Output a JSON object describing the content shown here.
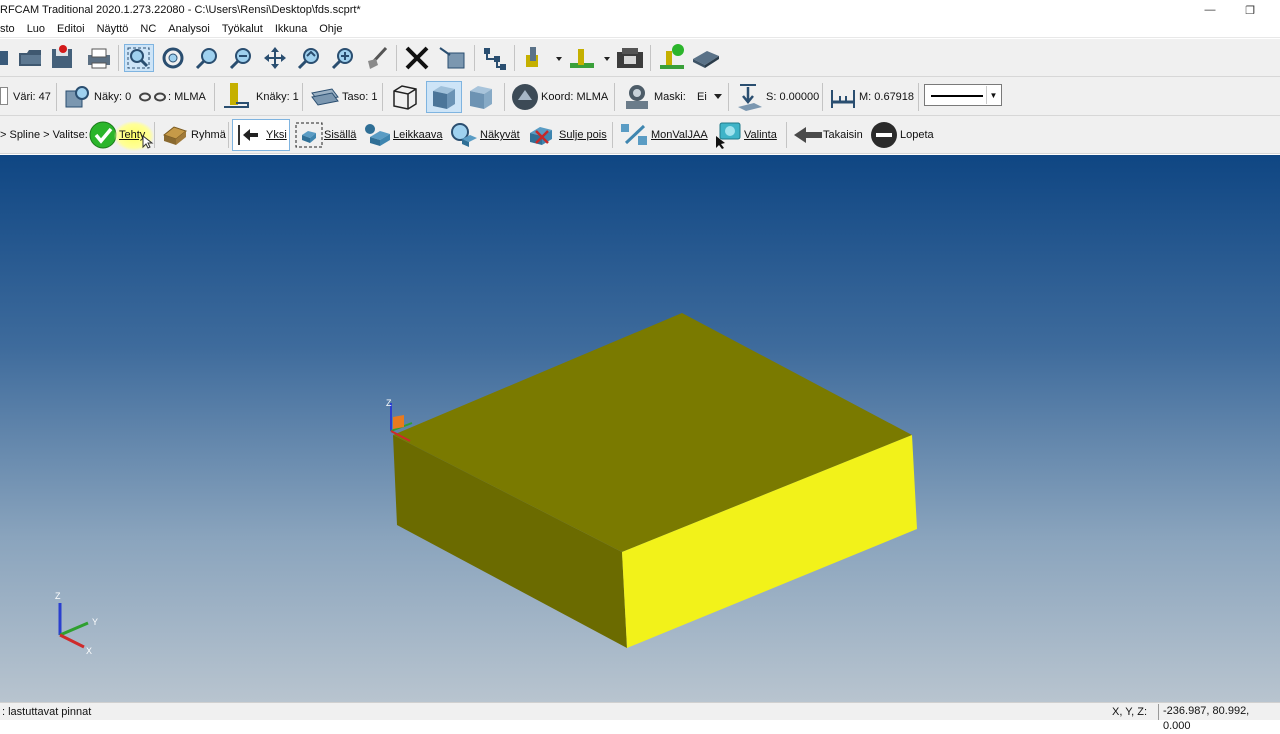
{
  "window": {
    "title": "RFCAM Traditional 2020.1.273.22080 - C:\\Users\\Rensi\\Desktop\\fds.scprt*",
    "minimize_glyph": "—",
    "restore_glyph": "❐"
  },
  "menu": [
    "sto",
    "Luo",
    "Editoi",
    "Näyttö",
    "NC",
    "Analysoi",
    "Työkalut",
    "Ikkuna",
    "Ohje"
  ],
  "toolbar2": {
    "color": "Väri: 47",
    "view": "Näky: 0",
    "mlma": ": MLMA",
    "cview": "Knäky: 1",
    "plane": "Taso: 1",
    "coord": "Koord: MLMA",
    "mask_label": "Maski:",
    "mask_value": "Ei",
    "s_value": "S: 0.00000",
    "m_value": "M: 0.67918"
  },
  "toolbar3": {
    "breadcrumb": "> Spline > Valitse:",
    "done": "Tehty",
    "group": "Ryhmä",
    "single": "Yksi",
    "inside": "Sisällä",
    "cutting": "Leikkaava",
    "visible": "Näkyvät",
    "exclude": "Sulje pois",
    "monvaljaa": "MonValJAA",
    "selection": "Valinta",
    "back": "Takaisin",
    "quit": "Lopeta"
  },
  "viewport": {
    "axis_labels": {
      "z": "Z",
      "y": "Y",
      "x": "X"
    }
  },
  "status": {
    "message": ": lastuttavat pinnat",
    "xyz_label": "X, Y, Z:",
    "coords": "-236.987, 80.992, 0.000"
  },
  "colors": {
    "box_top": "#7a7a00",
    "box_front": "#6b6b00",
    "box_right": "#f2f21a",
    "viewport_top": "#0f4683",
    "viewport_bottom": "#b8c4cf",
    "done_check": "#2bb52b",
    "highlight": "#ffff66"
  }
}
